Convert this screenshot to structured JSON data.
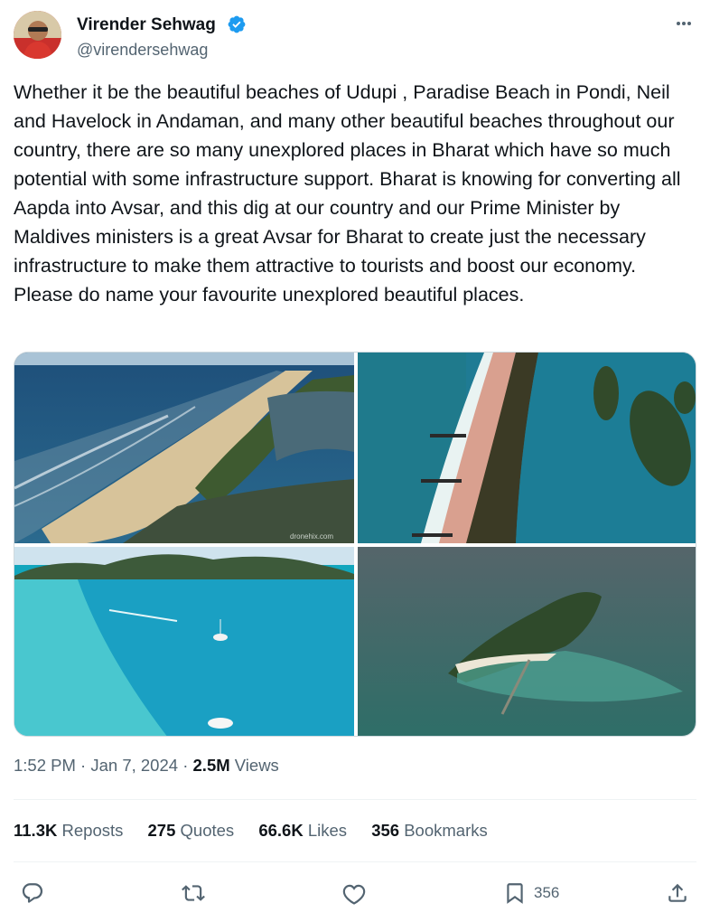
{
  "author": {
    "name": "Virender Sehwag",
    "handle": "@virendersehwag",
    "verified": true,
    "accent_color": "#1d9bf0"
  },
  "icons": {
    "verified": "verified-badge-icon",
    "more": "more-options-icon",
    "reply": "reply-icon",
    "repost": "repost-icon",
    "like": "like-icon",
    "bookmark": "bookmark-icon",
    "share": "share-icon"
  },
  "tweet": {
    "text": "Whether it be the beautiful beaches of Udupi , Paradise Beach in Pondi, Neil and Havelock in Andaman, and many other beautiful beaches throughout our country, there are so many unexplored places in Bharat which have so much potential with some infrastructure support. Bharat is knowing for converting all Aapda into Avsar, and this dig at our country and our Prime Minister by Maldives ministers is a great Avsar for Bharat to create just the necessary infrastructure to make them attractive to tourists and boost our economy. Please do name your favourite unexplored beautiful places."
  },
  "media": {
    "count": 4,
    "watermark": "dronehix.com"
  },
  "meta": {
    "time": "1:52 PM",
    "sep1": "·",
    "date": "Jan 7, 2024",
    "sep2": "·",
    "views_count": "2.5M",
    "views_label": "Views"
  },
  "stats": {
    "reposts_count": "11.3K",
    "reposts_label": "Reposts",
    "quotes_count": "275",
    "quotes_label": "Quotes",
    "likes_count": "66.6K",
    "likes_label": "Likes",
    "bookmarks_count": "356",
    "bookmarks_label": "Bookmarks"
  },
  "actions": {
    "bookmark_count": "356"
  }
}
